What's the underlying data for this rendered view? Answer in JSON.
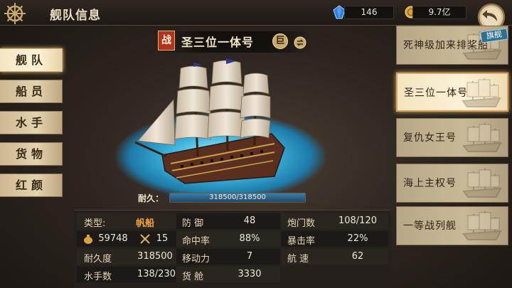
{
  "header": {
    "title": "舰队信息",
    "gems": "146",
    "gold": "9.7亿",
    "icons": {
      "menu": "ship-wheel-icon",
      "gem": "blue-gem-icon",
      "coin": "gold-coin-icon",
      "back": "back-arrow-icon"
    }
  },
  "nav": {
    "items": [
      {
        "label": "舰队",
        "active": true
      },
      {
        "label": "船员",
        "active": false
      },
      {
        "label": "水手",
        "active": false
      },
      {
        "label": "货物",
        "active": false
      },
      {
        "label": "红颜",
        "active": false
      }
    ]
  },
  "ship": {
    "badge": "战",
    "name": "圣三位一体号",
    "size": "巨",
    "durability_label": "耐久：",
    "durability_text": "318500/318500",
    "durability_current": 318500,
    "durability_max": 318500
  },
  "stats": {
    "type_key": "类型:",
    "type_value": "帆船",
    "supply_value": "59748",
    "crew_value": "15",
    "durability_key": "耐久度",
    "durability_value": "318500",
    "sailors_key": "水手数",
    "sailors_value": "138/230",
    "defense_key": "防 御",
    "defense_value": "48",
    "hit_key": "命中率",
    "hit_value": "88%",
    "move_key": "移动力",
    "move_value": "7",
    "cargo_key": "货 舱",
    "cargo_value": "3330",
    "cannon_key": "炮门数",
    "cannon_value": "108/120",
    "crit_key": "暴击率",
    "crit_value": "22%",
    "speed_key": "航 速",
    "speed_value": "62"
  },
  "fleet": {
    "flagship_tag": "旗舰",
    "ships": [
      {
        "name": "死神级加来排桨船",
        "active": false
      },
      {
        "name": "圣三位一体号",
        "active": true
      },
      {
        "name": "复仇女王号",
        "active": false
      },
      {
        "name": "海上主权号",
        "active": false
      },
      {
        "name": "一等战列舰",
        "active": false
      }
    ]
  },
  "colors": {
    "accent_orange": "#f0a33a",
    "war_badge_red": "#b3321d",
    "durability_blue": "#3c7fa8",
    "panel_gold": "#e3d3ae"
  }
}
